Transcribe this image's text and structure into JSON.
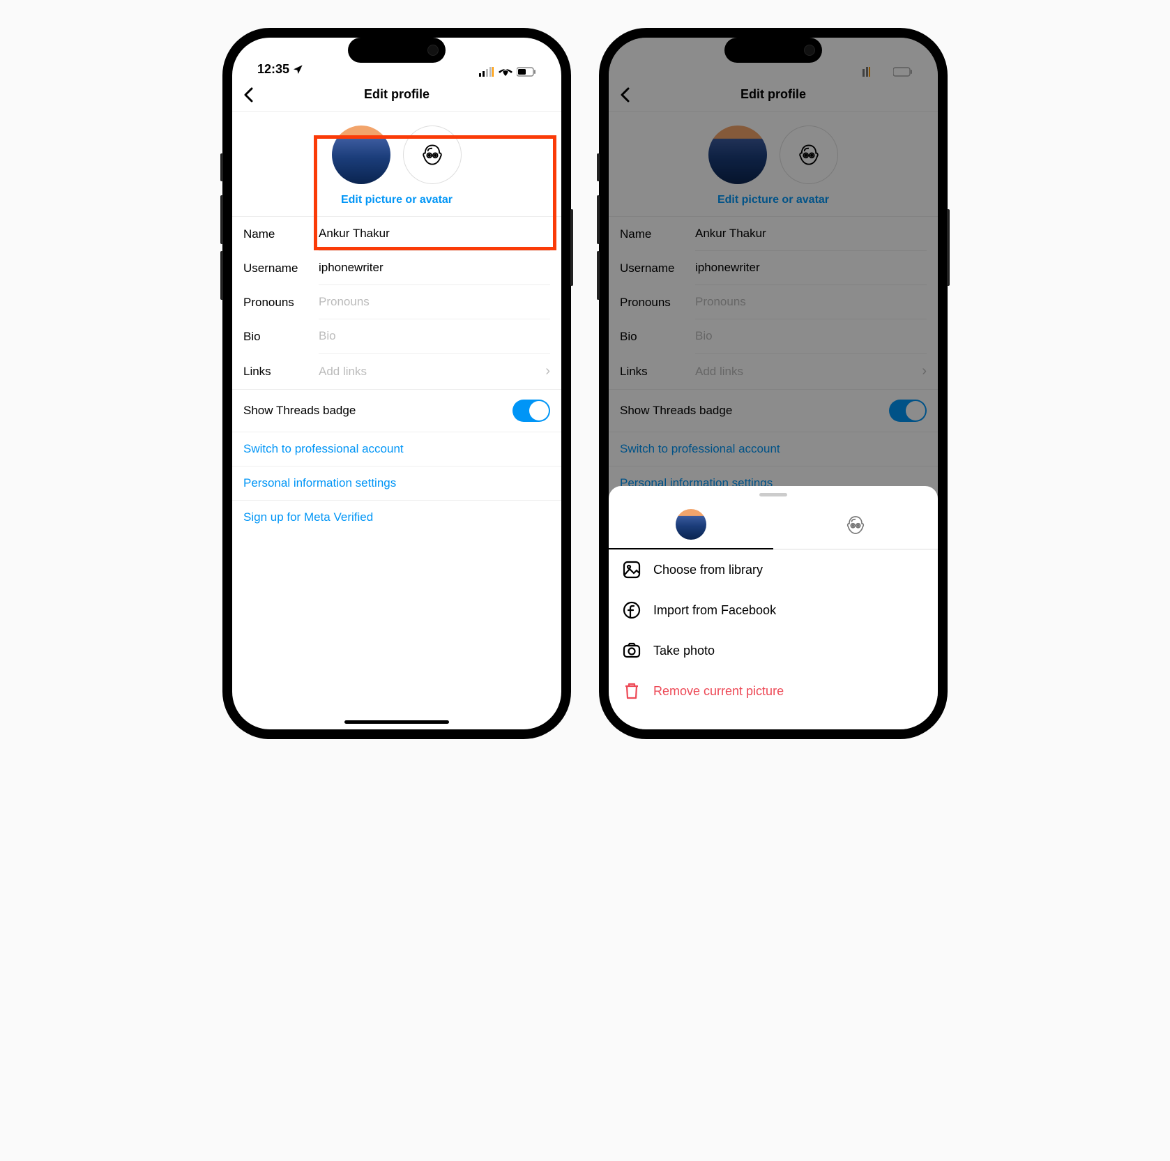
{
  "status": {
    "time": "12:35"
  },
  "header": {
    "title": "Edit profile"
  },
  "avatar": {
    "edit_link": "Edit picture or avatar"
  },
  "fields": {
    "name": {
      "label": "Name",
      "value": "Ankur Thakur"
    },
    "username": {
      "label": "Username",
      "value": "iphonewriter"
    },
    "pronouns": {
      "label": "Pronouns",
      "placeholder": "Pronouns"
    },
    "bio": {
      "label": "Bio",
      "placeholder": "Bio"
    },
    "links": {
      "label": "Links",
      "placeholder": "Add links"
    }
  },
  "toggle": {
    "label": "Show Threads badge",
    "on": true
  },
  "links": {
    "professional": "Switch to professional account",
    "personal_info": "Personal information settings",
    "meta_verified": "Sign up for Meta Verified"
  },
  "sheet": {
    "choose_library": "Choose from library",
    "import_facebook": "Import from Facebook",
    "take_photo": "Take photo",
    "remove": "Remove current picture"
  }
}
